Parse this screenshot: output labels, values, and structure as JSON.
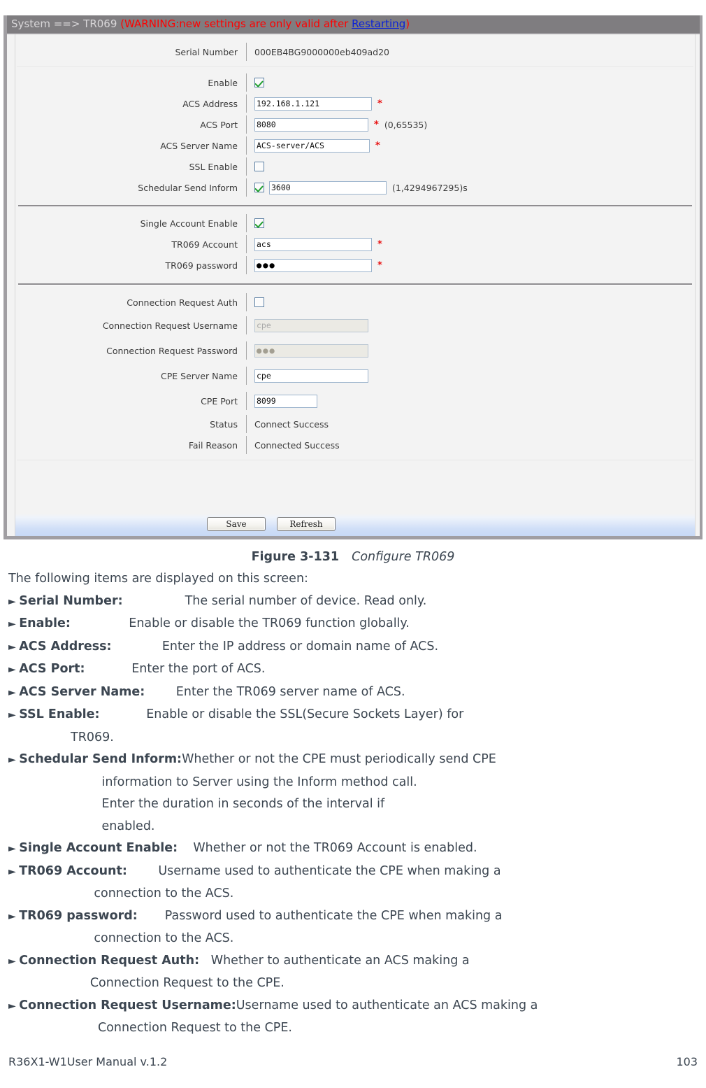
{
  "screen": {
    "titlebar": {
      "path": "System ==> TR069",
      "warning_prefix": "(WARNING:new settings are only valid after ",
      "restart_link": "Restarting",
      "warning_suffix": ")"
    },
    "rows": {
      "serial_number": {
        "label": "Serial Number",
        "value": "000EB4BG9000000eb409ad20"
      },
      "enable": {
        "label": "Enable",
        "checked": true
      },
      "acs_address": {
        "label": "ACS Address",
        "value": "192.168.1.121",
        "required": "*"
      },
      "acs_port": {
        "label": "ACS Port",
        "value": "8080",
        "required": "*",
        "hint": "(0,65535)"
      },
      "acs_server_name": {
        "label": "ACS Server Name",
        "value": "ACS-server/ACS",
        "required": "*"
      },
      "ssl_enable": {
        "label": "SSL Enable",
        "checked": false
      },
      "schedular_send_inform": {
        "label": "Schedular Send Inform",
        "checked": true,
        "value": "3600",
        "hint": "(1,4294967295)s"
      },
      "single_account_enable": {
        "label": "Single Account Enable",
        "checked": true
      },
      "tr069_account": {
        "label": "TR069 Account",
        "value": "acs",
        "required": "*"
      },
      "tr069_password": {
        "label": "TR069 password",
        "value": "●●●",
        "required": "*"
      },
      "connection_request_auth": {
        "label": "Connection Request Auth",
        "checked": false
      },
      "connection_request_username": {
        "label": "Connection Request Username",
        "value": "cpe",
        "disabled": true
      },
      "connection_request_password": {
        "label": "Connection Request Password",
        "value": "●●●",
        "disabled": true
      },
      "cpe_server_name": {
        "label": "CPE Server Name",
        "value": "cpe"
      },
      "cpe_port": {
        "label": "CPE Port",
        "value": "8099"
      },
      "status": {
        "label": "Status",
        "value": "Connect Success"
      },
      "fail_reason": {
        "label": "Fail Reason",
        "value": "Connected Success"
      }
    },
    "buttons": {
      "save": "Save",
      "refresh": "Refresh"
    },
    "colors": {
      "titlebar_bg": "#7f7d80",
      "warning_red": "#ff0000",
      "link_blue": "#0a21d8",
      "required_star": "#e81010",
      "check_green": "#1f9e2e",
      "panel_border": "#a09ea2"
    }
  },
  "caption": {
    "figure": "Figure 3-131",
    "title": "Configure TR069"
  },
  "doc": {
    "intro": "The following items are displayed on this screen:",
    "items": [
      {
        "arrow": "►",
        "term": "Serial Number:",
        "gap": "                ",
        "desc": "The serial number of device. Read only."
      },
      {
        "arrow": "►",
        "term": "Enable:",
        "gap": "               ",
        "desc": "Enable or disable the TR069 function globally."
      },
      {
        "arrow": "►",
        "term": "ACS Address:",
        "gap": "             ",
        "desc": "Enter the IP address or domain name of ACS."
      },
      {
        "arrow": "►",
        "term": "ACS Port:",
        "gap": "            ",
        "desc": "Enter the port of ACS."
      },
      {
        "arrow": "►",
        "term": "ACS Server Name:",
        "gap": "        ",
        "desc": "Enter the TR069 server name of ACS."
      },
      {
        "arrow": "►",
        "term": "SSL Enable:",
        "gap": "            ",
        "desc": "Enable or disable the SSL(Secure Sockets Layer) for",
        "continuations": [
          "                TR069."
        ]
      },
      {
        "arrow": "►",
        "term": "Schedular Send Inform:",
        "gap": "",
        "desc": "Whether or not the CPE must periodically send CPE",
        "continuations": [
          "                        information to Server using the Inform method call.",
          "                        Enter the duration in seconds of the interval if",
          "                        enabled."
        ]
      },
      {
        "arrow": "►",
        "term": "Single Account Enable:",
        "gap": "    ",
        "desc": "Whether or not the TR069 Account is enabled."
      },
      {
        "arrow": "►",
        "term": "TR069 Account:",
        "gap": "        ",
        "desc": "Username used to authenticate the CPE when making a",
        "continuations": [
          "                      connection to the ACS."
        ]
      },
      {
        "arrow": "►",
        "term": "TR069 password:",
        "gap": "       ",
        "desc": "Password used to authenticate the CPE when making a",
        "continuations": [
          "                      connection to the ACS."
        ]
      },
      {
        "arrow": "►",
        "term": "Connection Request Auth:",
        "gap": "   ",
        "desc": "Whether to authenticate an ACS making a",
        "continuations": [
          "                     Connection Request to the CPE."
        ]
      },
      {
        "arrow": "►",
        "term": "Connection Request Username:",
        "gap": "",
        "desc": "Username used to authenticate an ACS making a",
        "continuations": [
          "                       Connection Request to the CPE."
        ]
      }
    ]
  },
  "page_footer": {
    "manual": "R36X1-W1User Manual v.1.2",
    "page_number": "103"
  }
}
